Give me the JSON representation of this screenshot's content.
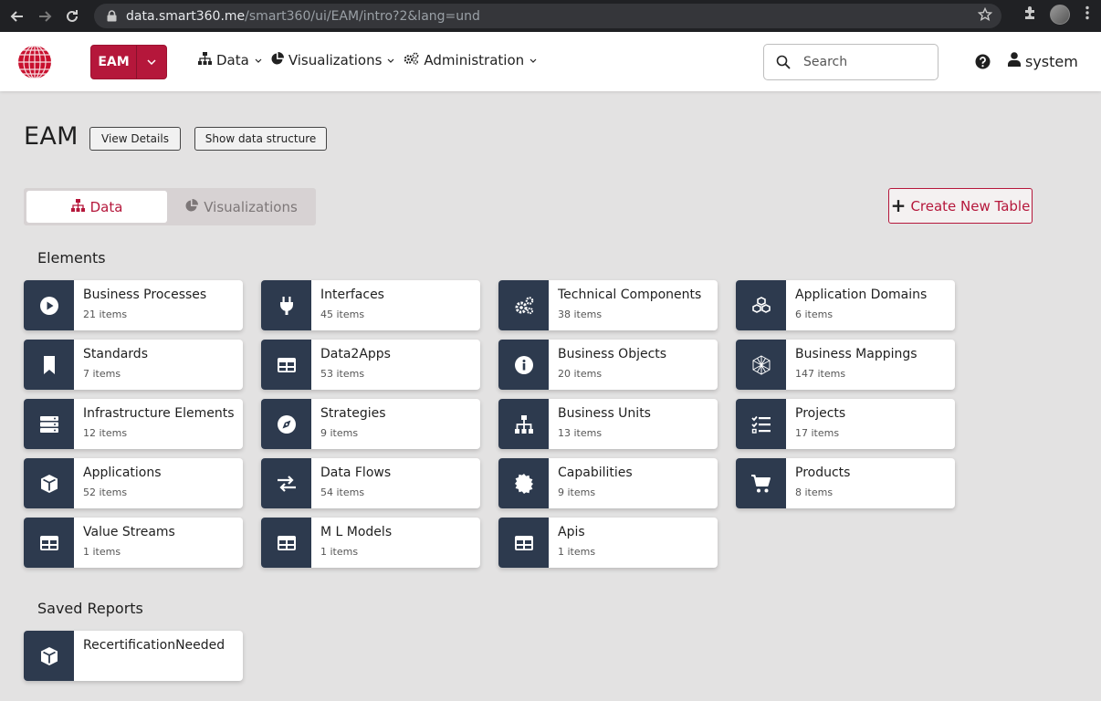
{
  "browser": {
    "url_host": "data.smart360.me",
    "url_path": "/smart360/ui/EAM/intro?2&lang=und"
  },
  "header": {
    "app_label": "EAM",
    "nav": [
      {
        "label": "Data",
        "icon": "sitemap-icon"
      },
      {
        "label": "Visualizations",
        "icon": "pie-chart-icon"
      },
      {
        "label": "Administration",
        "icon": "cogs-icon"
      }
    ],
    "search_placeholder": "Search",
    "user_name": "system"
  },
  "page": {
    "title": "EAM",
    "view_details_label": "View Details",
    "show_structure_label": "Show data structure",
    "toggle": {
      "data_label": "Data",
      "visualizations_label": "Visualizations"
    },
    "create_label": "Create New Table"
  },
  "elements_title": "Elements",
  "elements": [
    {
      "name": "Business Processes",
      "count": "21 items",
      "icon": "play-circle-icon"
    },
    {
      "name": "Interfaces",
      "count": "45 items",
      "icon": "plug-icon"
    },
    {
      "name": "Technical Components",
      "count": "38 items",
      "icon": "cogs-icon"
    },
    {
      "name": "Application Domains",
      "count": "6 items",
      "icon": "cubes-icon"
    },
    {
      "name": "Standards",
      "count": "7 items",
      "icon": "bookmark-icon"
    },
    {
      "name": "Data2Apps",
      "count": "53 items",
      "icon": "table-icon"
    },
    {
      "name": "Business Objects",
      "count": "20 items",
      "icon": "info-circle-icon"
    },
    {
      "name": "Business Mappings",
      "count": "147 items",
      "icon": "hexagon-mesh-icon"
    },
    {
      "name": "Infrastructure Elements",
      "count": "12 items",
      "icon": "server-icon"
    },
    {
      "name": "Strategies",
      "count": "9 items",
      "icon": "compass-icon"
    },
    {
      "name": "Business Units",
      "count": "13 items",
      "icon": "sitemap-icon"
    },
    {
      "name": "Projects",
      "count": "17 items",
      "icon": "tasks-icon"
    },
    {
      "name": "Applications",
      "count": "52 items",
      "icon": "cube-icon"
    },
    {
      "name": "Data Flows",
      "count": "54 items",
      "icon": "exchange-icon"
    },
    {
      "name": "Capabilities",
      "count": "9 items",
      "icon": "certificate-icon"
    },
    {
      "name": "Products",
      "count": "8 items",
      "icon": "cart-icon"
    },
    {
      "name": "Value Streams",
      "count": "1 items",
      "icon": "table-icon"
    },
    {
      "name": "M L Models",
      "count": "1 items",
      "icon": "table-icon"
    },
    {
      "name": "Apis",
      "count": "1 items",
      "icon": "table-icon"
    }
  ],
  "saved_reports_title": "Saved Reports",
  "saved_reports": [
    {
      "name": "RecertificationNeeded",
      "icon": "cube-icon"
    }
  ],
  "colors": {
    "brand": "#b5173b",
    "tile": "#2d3a4e",
    "background": "#e3e2e2"
  }
}
